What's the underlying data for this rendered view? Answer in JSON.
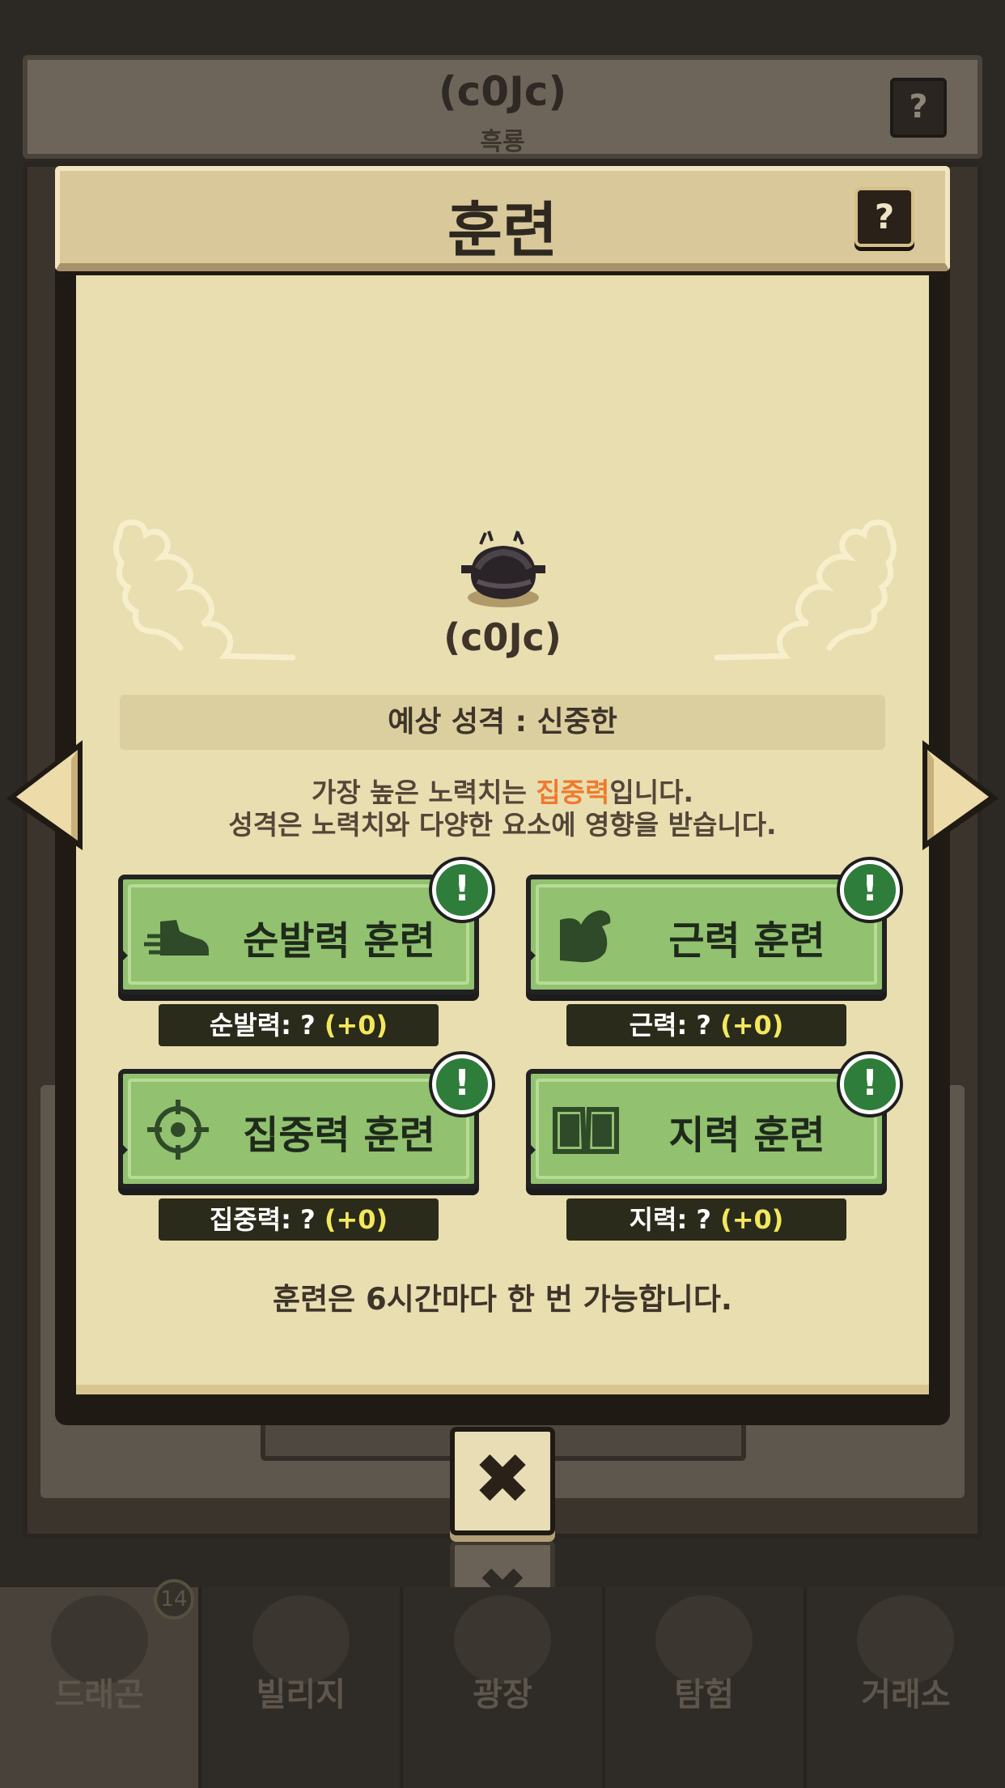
{
  "background": {
    "header_title": "(c0Jc)",
    "header_subtitle": "흑룡",
    "help_icon": "?",
    "close_icon": "✖",
    "tabs": [
      {
        "label": "드래곤",
        "badge": "14",
        "icon": "dragon-icon"
      },
      {
        "label": "빌리지",
        "icon": "village-icon"
      },
      {
        "label": "광장",
        "icon": "plaza-icon"
      },
      {
        "label": "탐험",
        "icon": "compass-icon"
      },
      {
        "label": "거래소",
        "icon": "shop-icon"
      }
    ]
  },
  "modal": {
    "title": "훈련",
    "help_icon": "?",
    "creature_name": "(c0Jc)",
    "personality_text": "예상 성격 : 신중한",
    "desc_line1_prefix": "가장 높은 노력치는 ",
    "desc_line1_highlight": "집중력",
    "desc_line1_suffix": "입니다.",
    "desc_line2": "성격은 노력치와 다양한 요소에 영향을 받습니다.",
    "alert_icon": "!",
    "training_buttons": [
      {
        "label": "순발력 훈련",
        "icon": "sneaker-icon",
        "stat_label": "순발력: ? ",
        "stat_gain": "(+0)"
      },
      {
        "label": "근력 훈련",
        "icon": "muscle-arm-icon",
        "stat_label": "근력: ? ",
        "stat_gain": "(+0)"
      },
      {
        "label": "집중력 훈련",
        "icon": "crosshair-icon",
        "stat_label": "집중력: ? ",
        "stat_gain": "(+0)"
      },
      {
        "label": "지력 훈련",
        "icon": "open-book-icon",
        "stat_label": "지력: ? ",
        "stat_gain": "(+0)"
      }
    ],
    "footer_note": "훈련은 6시간마다 한 번 가능합니다.",
    "close_icon": "✖"
  },
  "colors": {
    "paper": "#e9deb0",
    "button_green": "#92c170",
    "highlight_orange": "#ee7a2e",
    "stat_gain_yellow": "#f3e85c",
    "badge_green": "#2f7d3a"
  }
}
